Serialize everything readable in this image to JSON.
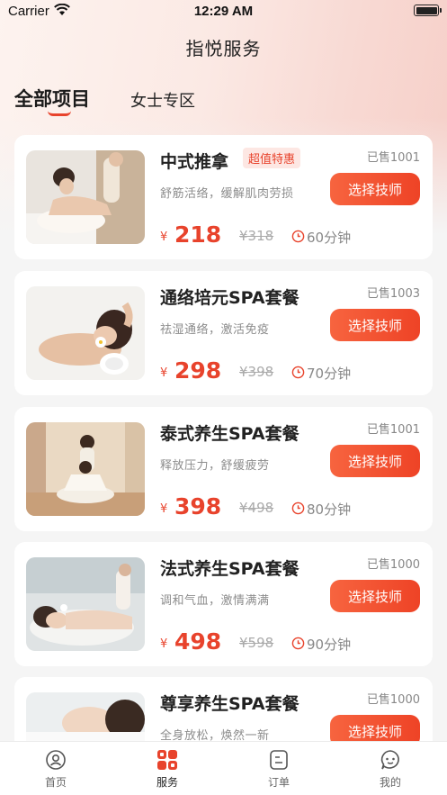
{
  "status_bar": {
    "carrier": "Carrier",
    "time": "12:29 AM"
  },
  "nav": {
    "title": "指悦服务"
  },
  "tabs": [
    {
      "label": "全部项目",
      "active": true
    },
    {
      "label": "女士专区",
      "active": false
    }
  ],
  "services": [
    {
      "name": "中式推拿",
      "badge": "超值特惠",
      "sold": "已售1001",
      "desc": "舒筋活络，缓解肌肉劳损",
      "button": "选择技师",
      "currency": "¥",
      "price": "218",
      "original_price": "¥318",
      "duration": "60分钟"
    },
    {
      "name": "通络培元SPA套餐",
      "badge": "",
      "sold": "已售1003",
      "desc": "祛湿通络，激活免疫",
      "button": "选择技师",
      "currency": "¥",
      "price": "298",
      "original_price": "¥398",
      "duration": "70分钟"
    },
    {
      "name": "泰式养生SPA套餐",
      "badge": "",
      "sold": "已售1001",
      "desc": "释放压力，舒缓疲劳",
      "button": "选择技师",
      "currency": "¥",
      "price": "398",
      "original_price": "¥498",
      "duration": "80分钟"
    },
    {
      "name": "法式养生SPA套餐",
      "badge": "",
      "sold": "已售1000",
      "desc": "调和气血，激情满满",
      "button": "选择技师",
      "currency": "¥",
      "price": "498",
      "original_price": "¥598",
      "duration": "90分钟"
    },
    {
      "name": "尊享养生SPA套餐",
      "badge": "",
      "sold": "已售1000",
      "desc": "全身放松，焕然一新",
      "button": "选择技师",
      "currency": "¥",
      "price": "",
      "original_price": "",
      "duration": ""
    }
  ],
  "tabbar": [
    {
      "label": "首页",
      "icon": "home-icon",
      "active": false
    },
    {
      "label": "服务",
      "icon": "grid-icon",
      "active": true
    },
    {
      "label": "订单",
      "icon": "order-icon",
      "active": false
    },
    {
      "label": "我的",
      "icon": "profile-icon",
      "active": false
    }
  ],
  "colors": {
    "accent": "#e8432c",
    "button_start": "#f7643f",
    "button_end": "#ee4326"
  }
}
